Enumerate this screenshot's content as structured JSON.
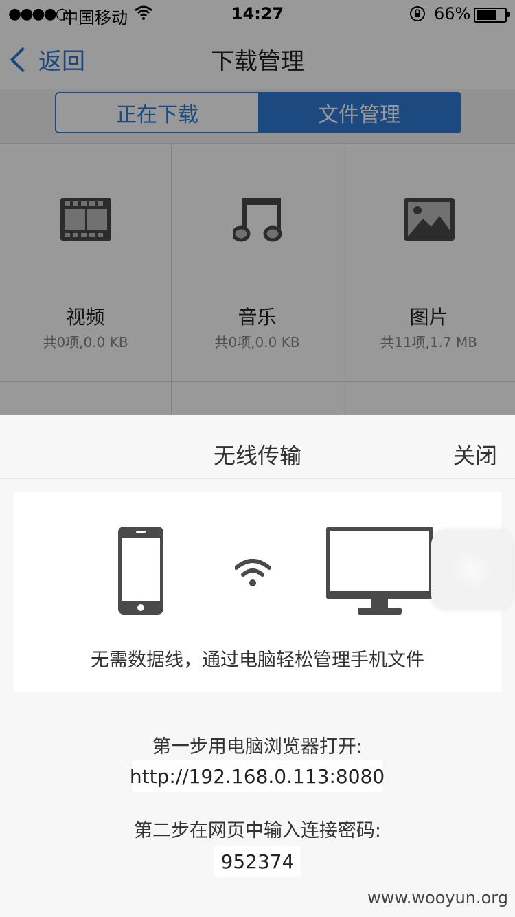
{
  "status_bar": {
    "signal": "●●●●○",
    "carrier": "中国移动",
    "time": "14:27",
    "battery_pct": "66%"
  },
  "nav": {
    "back_label": "返回",
    "title": "下载管理"
  },
  "segments": {
    "downloading": "正在下载",
    "file_manage": "文件管理",
    "selected": "文件管理"
  },
  "categories": [
    {
      "name": "视频",
      "info": "共0项,0.0 KB",
      "icon": "film-icon"
    },
    {
      "name": "音乐",
      "info": "共0项,0.0 KB",
      "icon": "music-note-icon"
    },
    {
      "name": "图片",
      "info": "共11项,1.7 MB",
      "icon": "image-icon"
    }
  ],
  "sheet": {
    "title": "无线传输",
    "close_label": "关闭",
    "description": "无需数据线，通过电脑轻松管理手机文件",
    "step1_label": "第一步用电脑浏览器打开:",
    "step1_value": "http://192.168.0.113:8080",
    "step2_label": "第二步在网页中输入连接密码:",
    "step2_value": "952374"
  },
  "watermark": "www.wooyun.org",
  "colors": {
    "accent": "#2f7bd6",
    "icon_gray": "#4a4a4a",
    "overlay": "rgba(0,0,0,0.40)"
  }
}
